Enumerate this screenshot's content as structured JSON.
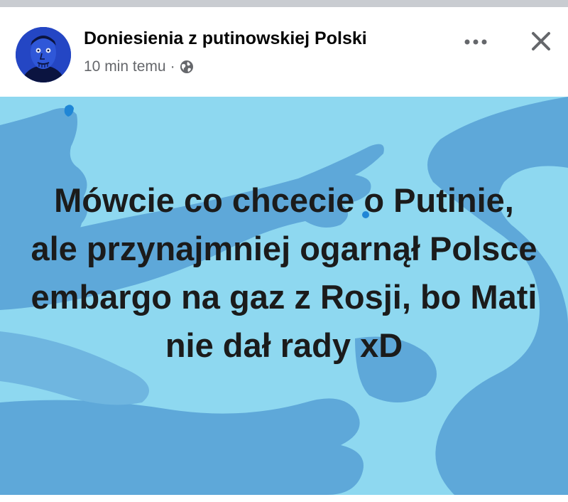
{
  "post": {
    "page_name": "Doniesienia z putinowskiej Polski",
    "timestamp": "10 min temu",
    "separator": "·",
    "privacy_icon": "globe-icon",
    "more_icon": "more-options-icon",
    "close_icon": "close-icon",
    "avatar_icon": "blue-face-avatar",
    "image_text": "Mówcie co chcecie o Putinie, ale przynajmniej ogarnął Polsce embargo na gaz z Rosji, bo Mati nie dał rady xD"
  },
  "colors": {
    "image_background": "#8ed8f0",
    "image_shapes": "#5ea8d9",
    "text": "#1b1b1b",
    "meta_text": "#65676b"
  }
}
